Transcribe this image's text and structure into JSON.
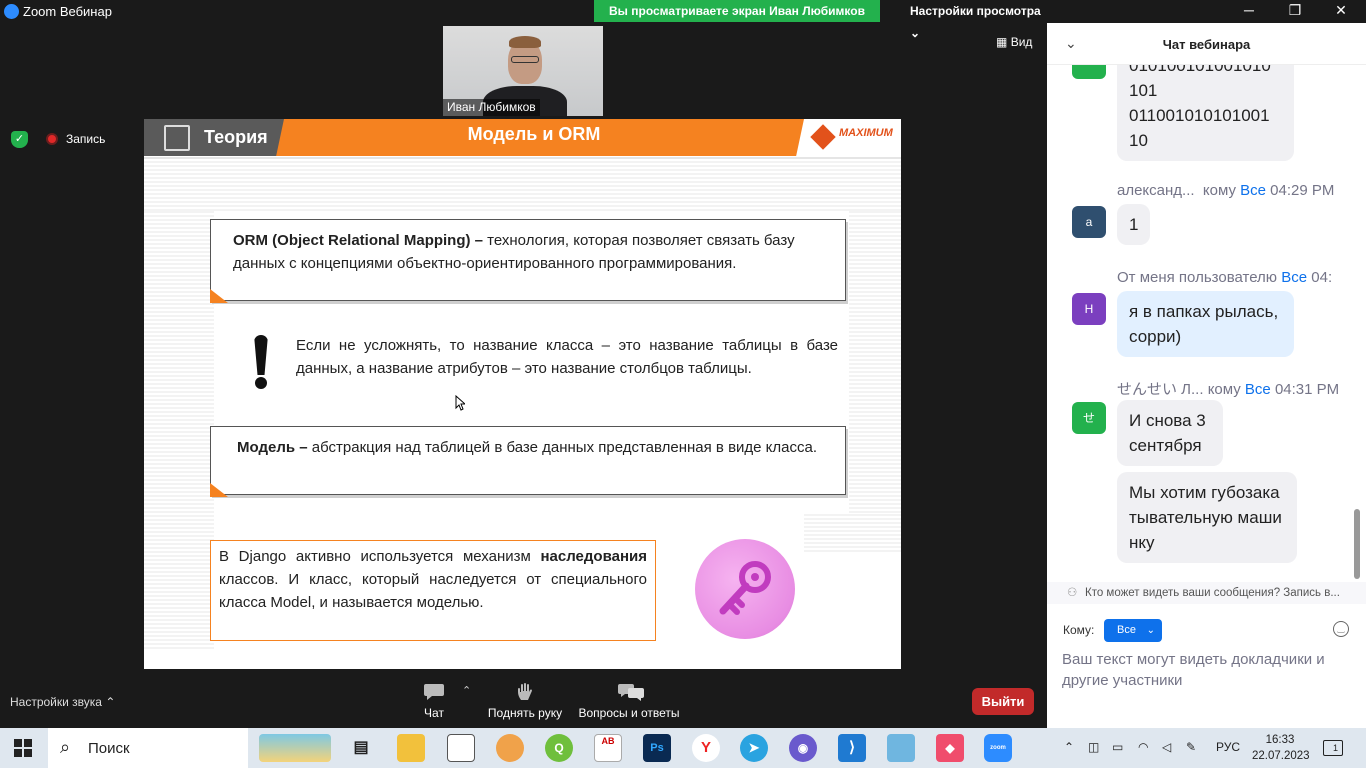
{
  "window": {
    "title": "Zoom Вебинар",
    "share_banner": "Вы просматриваете экран Иван Любимков",
    "view_settings": "Настройки просмотра",
    "minimize": "─",
    "restore": "❐",
    "close": "✕"
  },
  "meeting": {
    "participant_name": "Иван Любимков",
    "view_button": "Вид",
    "record_label": "Запись"
  },
  "slide": {
    "section": "Теория",
    "title": "Модель и ORM",
    "logo_name": "MAXIMUM",
    "box1_bold": "ORM (Object Relational Mapping) –",
    "box1_text": " технология, которая позволяет связать базу данных с концепциями объектно-ориентированного программирования.",
    "note_text": "Если не усложнять, то название класса – это название таблицы в базе данных, а название атрибутов – это название столбцов таблицы.",
    "box2_bold": "Модель –",
    "box2_text": " абстракция над таблицей в базе данных представленная в виде класса.",
    "box3_pre": "В Django активно используется механизм ",
    "box3_bold": "наследования",
    "box3_post": " классов. И класс, который наследуется от специального класса Model, и называется моделью."
  },
  "toolbar": {
    "audio_settings": "Настройки звука",
    "chat": "Чат",
    "raise_hand": "Поднять руку",
    "qa": "Вопросы и ответы",
    "leave": "Выйти"
  },
  "chat": {
    "title": "Чат вебинара",
    "messages": [
      {
        "text": "010100101001010\n101\n011001010101001\n10",
        "avatar_letter": "",
        "avatar_color": "#23b14d"
      },
      {
        "sender": "александ...",
        "to_word": "кому",
        "to": "Все",
        "time": "04:29 PM",
        "avatar_letter": "а",
        "avatar_color": "#2f4f6f",
        "text": "1"
      },
      {
        "sender": "От меня пользователю",
        "to": "Все",
        "time": "04:",
        "avatar_letter": "Н",
        "avatar_color": "#7b3fbf",
        "text": "я в папках рылась, сорри)"
      },
      {
        "sender": "せんせい Л...",
        "to_word": "кому",
        "to": "Все",
        "time": "04:31 PM",
        "avatar_letter": "せ",
        "avatar_color": "#23b14d",
        "text": "И снова 3 сентября"
      },
      {
        "text": "Мы хотим губозакатывательную машинку"
      }
    ],
    "privacy_notice": "Кто может видеть ваши сообщения? Запись в...",
    "to_label": "Кому:",
    "to_value": "Все",
    "input_placeholder": "Ваш текст могут видеть докладчики и другие участники"
  },
  "taskbar": {
    "search_label": "Поиск",
    "lang": "РУС",
    "time": "16:33",
    "date": "22.07.2023",
    "notifications_count": "1"
  }
}
